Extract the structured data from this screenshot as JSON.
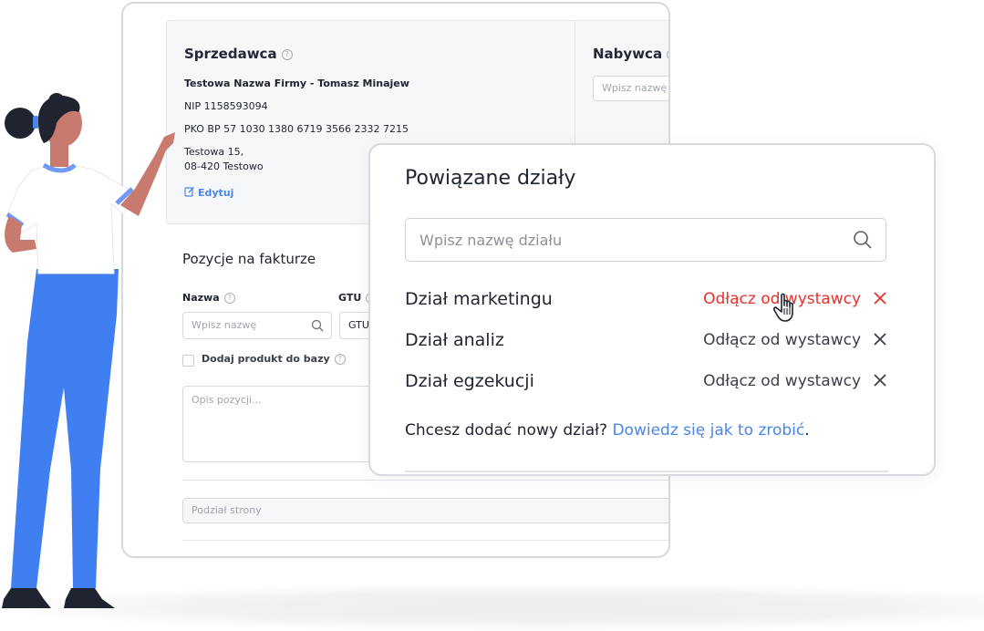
{
  "invoice": {
    "seller": {
      "title": "Sprzedawca",
      "company": "Testowa Nazwa Firmy - Tomasz Minajew",
      "nip": "NIP 1158593094",
      "bank": "PKO BP 57 1030 1380 6719 3566 2332 7215",
      "street": "Testowa 15,",
      "city": "08-420 Testowo",
      "edit_label": "Edytuj"
    },
    "buyer": {
      "title": "Nabywca",
      "search_placeholder": "Wpisz nazwę k"
    },
    "positions": {
      "title": "Pozycje na fakturze",
      "name_label": "Nazwa",
      "name_placeholder": "Wpisz nazwę",
      "gtu_label": "GTU",
      "gtu_value": "GTU",
      "add_product_label": "Dodaj produkt do bazy",
      "description_placeholder": "Opis pozycji...",
      "page_split_placeholder": "Podział strony"
    },
    "help_glyph": "?"
  },
  "modal": {
    "title": "Powiązane działy",
    "search_placeholder": "Wpisz nazwę działu",
    "departments": [
      {
        "name": "Dział marketingu",
        "action_label": "Odłącz od wystawcy",
        "hovered": true
      },
      {
        "name": "Dział analiz",
        "action_label": "Odłącz od wystawcy",
        "hovered": false
      },
      {
        "name": "Dział egzekucji",
        "action_label": "Odłącz od wystawcy",
        "hovered": false
      }
    ],
    "footer_text": "Chcesz dodać nowy dział?",
    "footer_link": "Dowiedz się jak to zrobić",
    "footer_end": "."
  },
  "colors": {
    "accent_blue": "#4a86e8",
    "danger_red": "#e5322d",
    "text_dark": "#1f2430",
    "action_gray": "#3a3f4b"
  }
}
